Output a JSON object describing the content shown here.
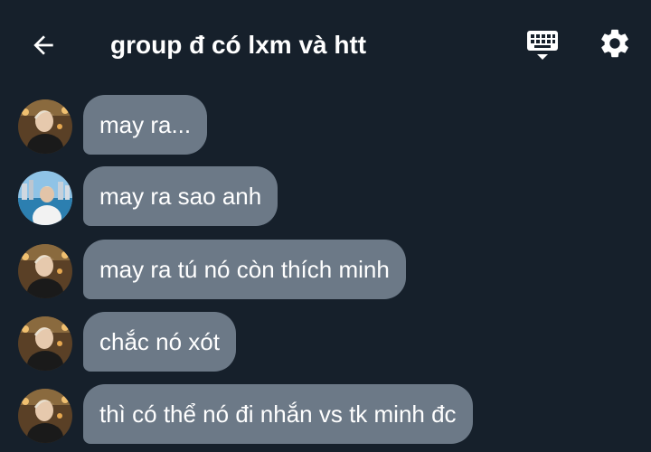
{
  "header": {
    "title": "group đ có lxm và htt",
    "back_icon": "arrow-left-icon",
    "keyboard_icon": "keyboard-icon",
    "settings_icon": "gear-icon"
  },
  "colors": {
    "background": "#16202b",
    "bubble": "#6c7987",
    "text": "#ffffff"
  },
  "messages": [
    {
      "sender": "avatar-1",
      "text": "may ra..."
    },
    {
      "sender": "avatar-2",
      "text": "may ra sao anh"
    },
    {
      "sender": "avatar-1",
      "text": "may ra tú nó còn thích minh"
    },
    {
      "sender": "avatar-1",
      "text": "chắc nó xót"
    },
    {
      "sender": "avatar-1",
      "text": "thì có thể nó đi nhắn vs tk minh đc"
    }
  ]
}
